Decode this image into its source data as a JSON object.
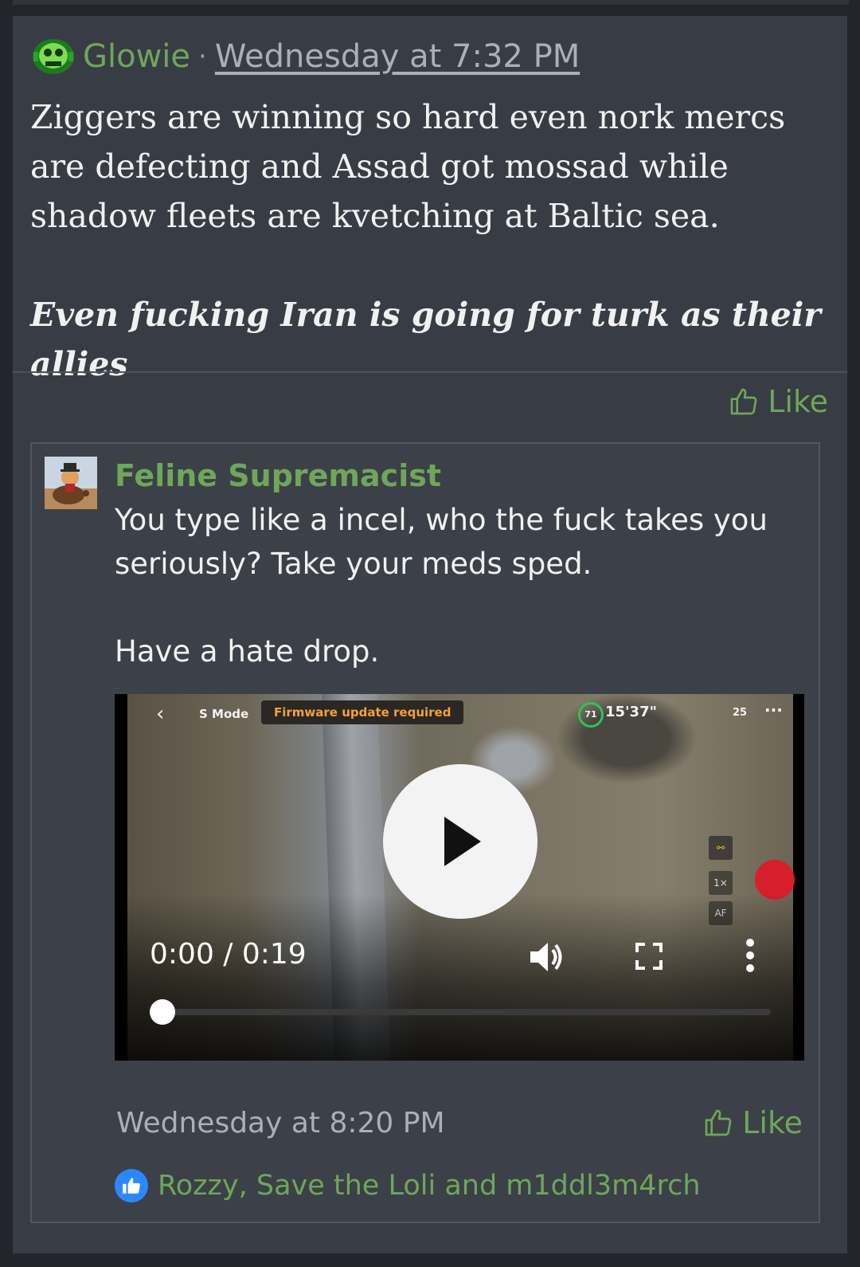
{
  "post": {
    "author": "Glowie",
    "separator": "·",
    "timestamp": "Wednesday at 7:32 PM",
    "body_paragraph": "Ziggers are winning so hard even nork mercs are defecting and Assad got mossad while shadow fleets are kvetching at Baltic sea.",
    "body_emphasis": "Even fucking Iran is going for turk as their allies",
    "like_label": "Like"
  },
  "quote": {
    "author": "Feline Supremacist",
    "line1": "You type like a incel, who the fuck takes you seriously? Take your meds sped.",
    "line2": "Have a hate drop.",
    "video": {
      "hud_smode": "S Mode",
      "hud_firmware": "Firmware update required",
      "hud_battery": "71",
      "hud_timer": "15'37\"",
      "hud_sats": "25",
      "hud_zoom": "1×",
      "hud_af": "AF",
      "time_display": "0:00 / 0:19",
      "progress": 0
    },
    "timestamp": "Wednesday at 8:20 PM",
    "like_label": "Like",
    "reactions": "Rozzy, Save the Loli and m1ddl3m4rch"
  },
  "colors": {
    "accent_green": "#6fa65a",
    "post_bg": "#383c44",
    "quote_bg": "#3c4048",
    "reaction_blue": "#2d88ff"
  },
  "icons": [
    "glowie-avatar",
    "thumbs-up-icon",
    "play-icon",
    "volume-icon",
    "fullscreen-icon",
    "more-vertical-icon",
    "like-reaction-icon"
  ]
}
